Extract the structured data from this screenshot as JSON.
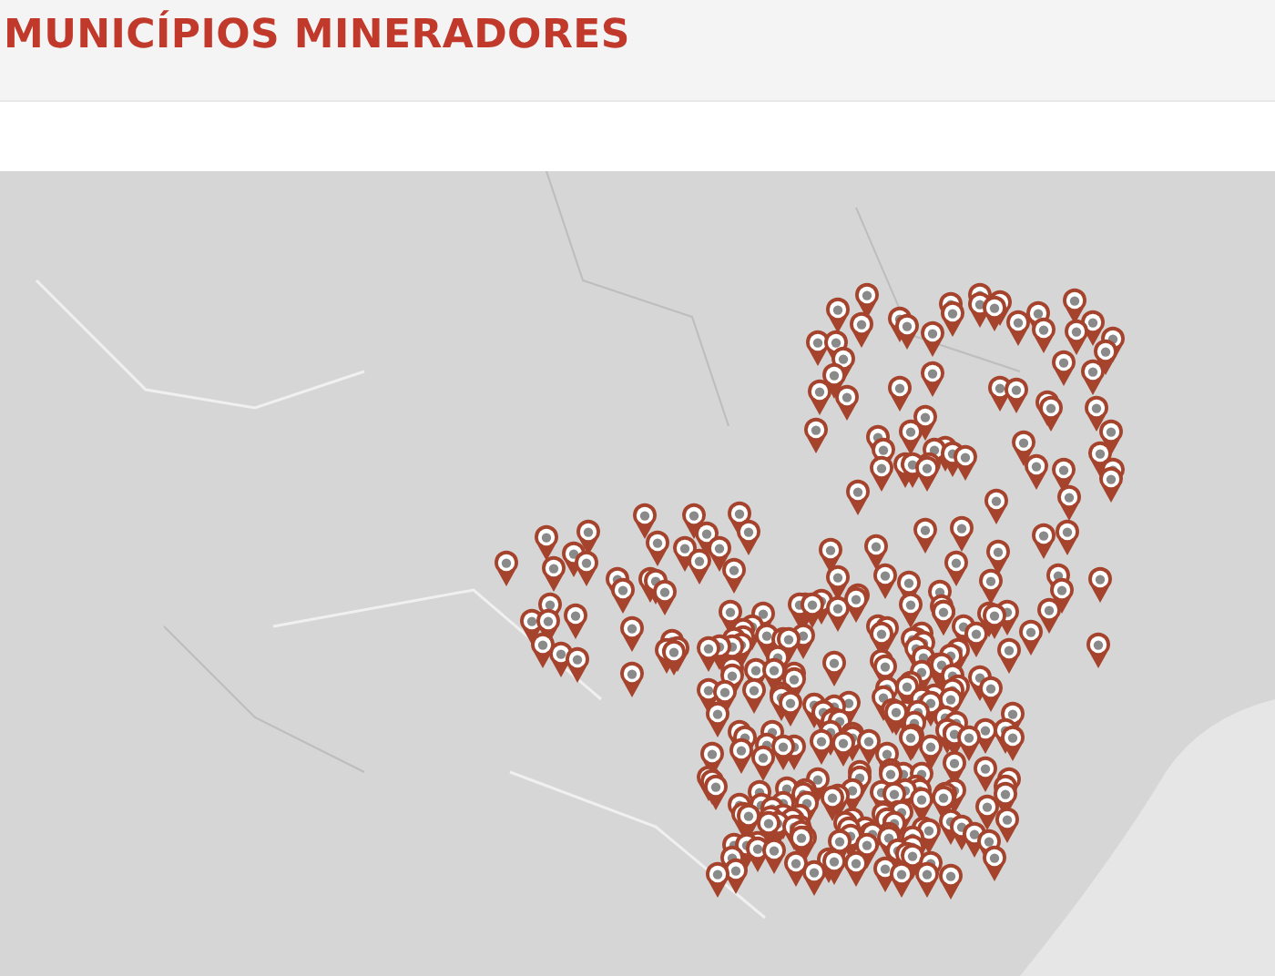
{
  "header": {
    "title": "MUNICÍPIOS MINERADORES"
  }
}
